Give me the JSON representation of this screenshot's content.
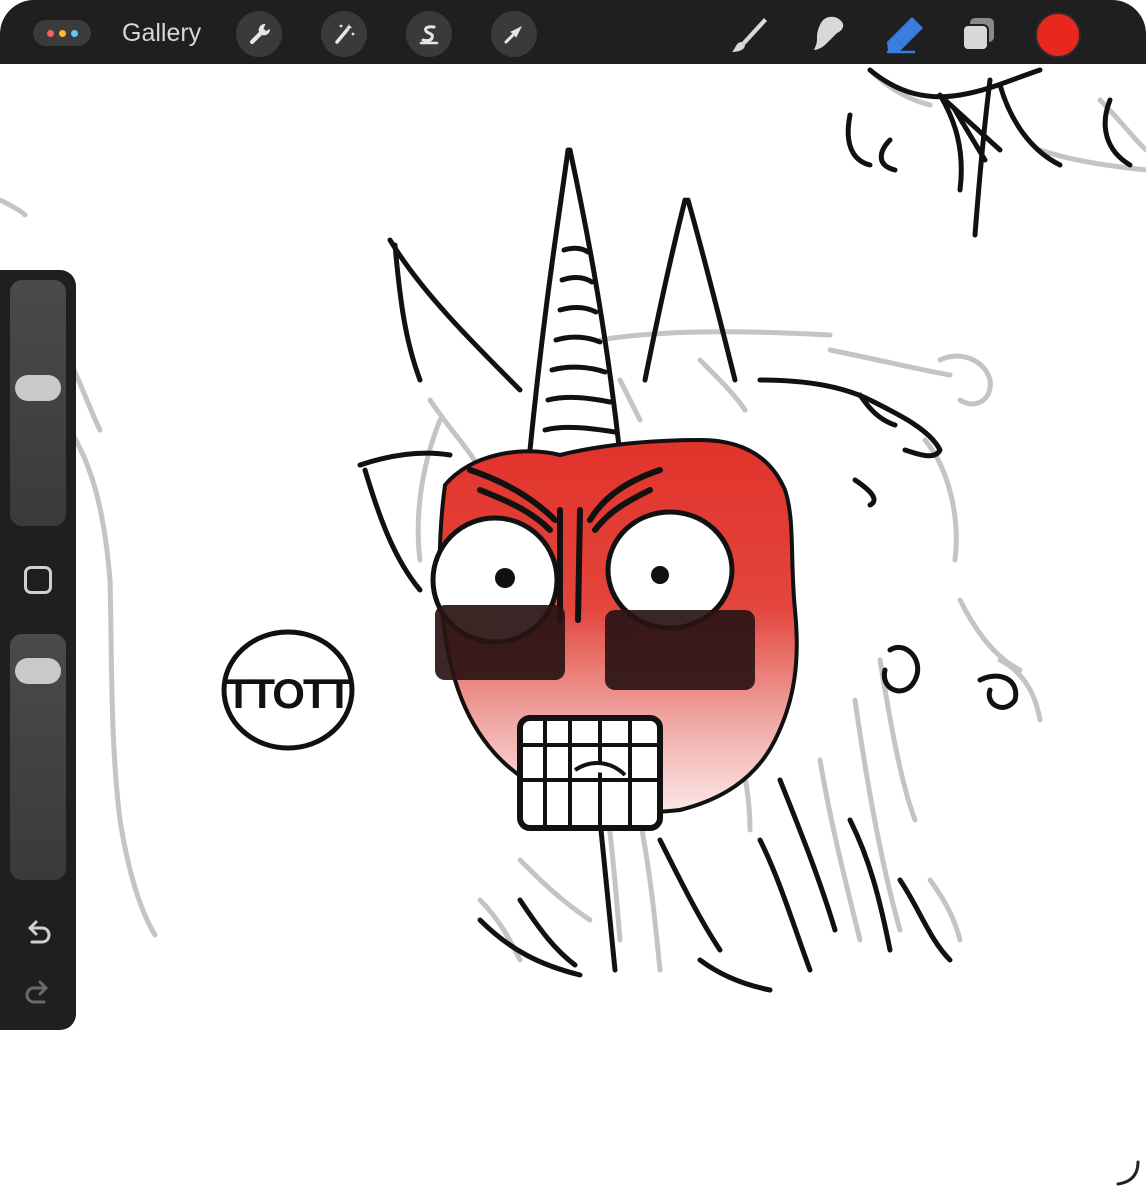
{
  "toolbar": {
    "gallery_label": "Gallery",
    "menu_dots_colors": [
      "#ff5f57",
      "#febc2e",
      "#5cc8ff"
    ],
    "left_tools": [
      {
        "name": "actions-wrench-icon"
      },
      {
        "name": "adjustments-wand-icon"
      },
      {
        "name": "selection-s-icon"
      },
      {
        "name": "transform-arrow-icon"
      }
    ],
    "right_tools": [
      {
        "name": "brush-icon"
      },
      {
        "name": "smudge-icon"
      },
      {
        "name": "eraser-icon",
        "active": true
      },
      {
        "name": "layers-icon"
      }
    ],
    "current_color": "#e8281e",
    "active_tool_color": "#3a7de0"
  },
  "sidebar": {
    "size_slider_level": 0.47,
    "opacity_slider_level": 0.07
  },
  "canvas": {
    "speech_bubble_text": "TTOTT"
  }
}
